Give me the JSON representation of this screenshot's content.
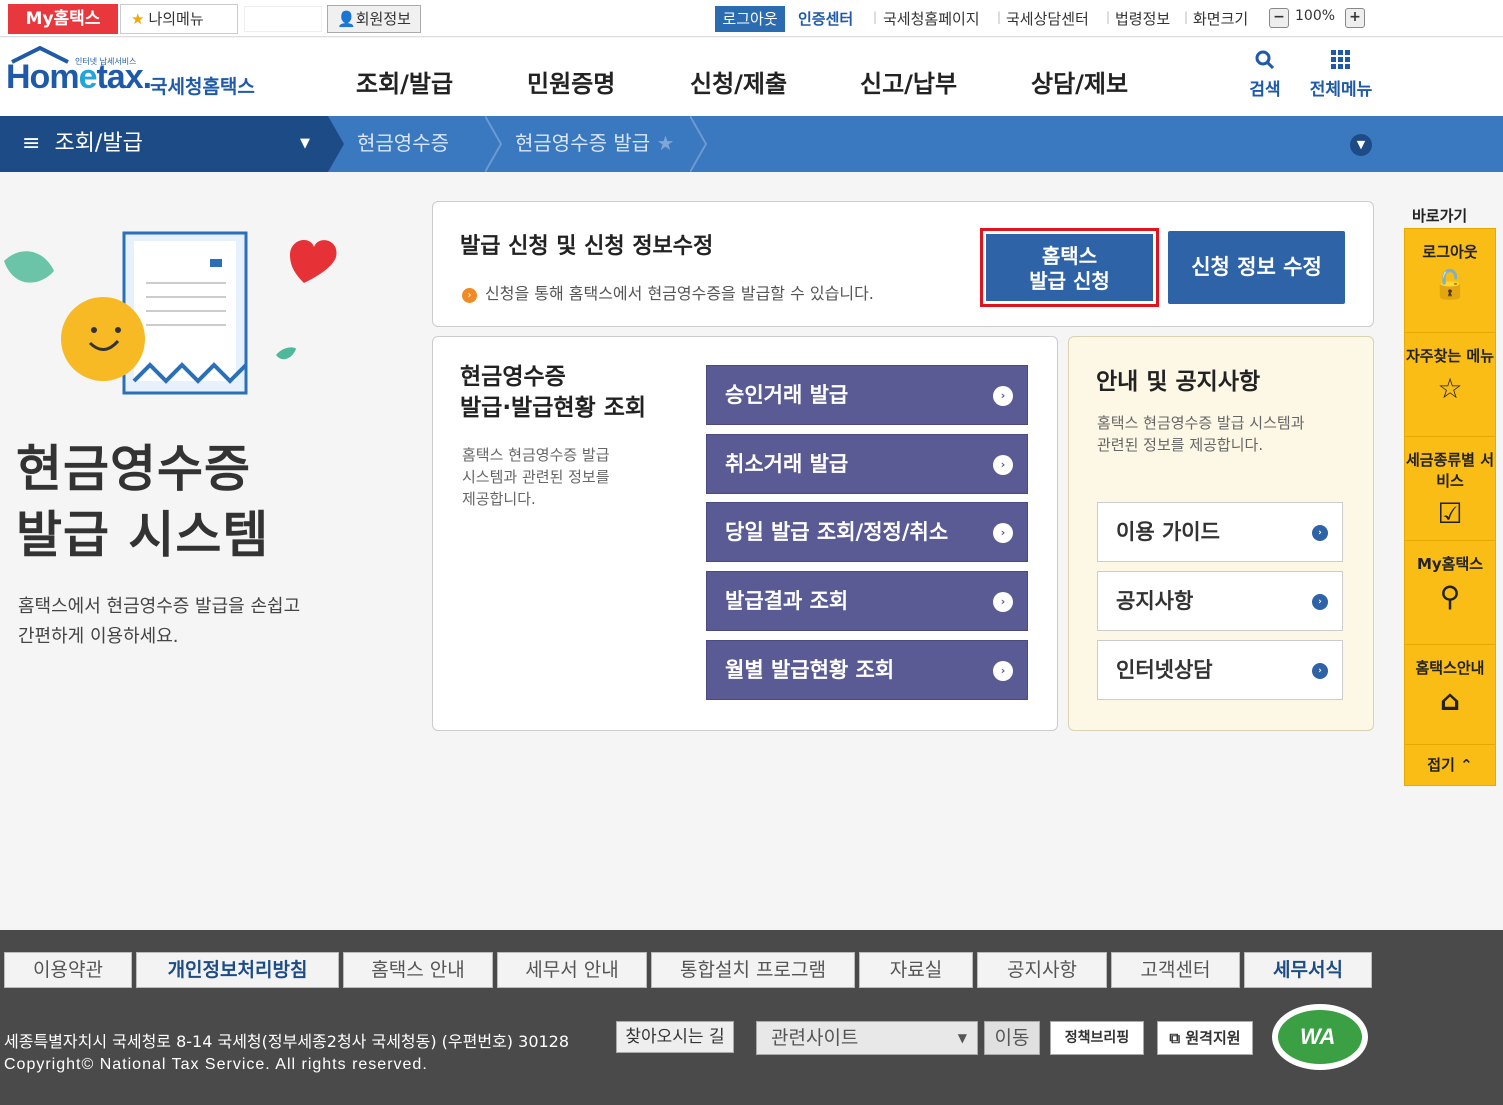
{
  "topbar": {
    "my_hometax": "My홈택스",
    "my_menu": "나의메뉴",
    "member_info": "회원정보",
    "logout": "로그아웃",
    "links": [
      "인증센터",
      "국세청홈페이지",
      "국세상담센터",
      "법령정보",
      "화면크기"
    ],
    "zoom": "100%"
  },
  "header": {
    "logo_text_a": "Hom",
    "logo_text_b": "e",
    "logo_text_c": "tax.",
    "logo_small": "인터넷 납세서비스",
    "logo_kor": "국세청홈택스",
    "nav": [
      "조회/발급",
      "민원증명",
      "신청/제출",
      "신고/납부",
      "상담/제보"
    ],
    "search": "검색",
    "all_menu": "전체메뉴"
  },
  "breadcrumb": {
    "main": "조회/발급",
    "items": [
      "현금영수증",
      "현금영수증 발급"
    ]
  },
  "hero": {
    "title_line1": "현금영수증",
    "title_line2": "발급 시스템",
    "desc_line1": "홈택스에서 현금영수증 발급을 손쉽고",
    "desc_line2": "간편하게 이용하세요."
  },
  "apply_panel": {
    "title": "발급 신청 및 신청 정보수정",
    "desc": "신청을 통해 홈택스에서 현금영수증을 발급할 수 있습니다.",
    "btn_apply_line1": "홈택스",
    "btn_apply_line2": "발급 신청",
    "btn_modify": "신청 정보 수정"
  },
  "query_panel": {
    "title_line1": "현금영수증",
    "title_line2": "발급·발급현황 조회",
    "desc_line1": "홈택스 현금영수증 발급",
    "desc_line2": "시스템과 관련된 정보를",
    "desc_line3": "제공합니다.",
    "buttons": [
      "승인거래 발급",
      "취소거래 발급",
      "당일 발급 조회/정정/취소",
      "발급결과 조회",
      "월별 발급현황 조회"
    ]
  },
  "notice_panel": {
    "title": "안내 및 공지사항",
    "desc_line1": "홈택스 현금영수증 발급 시스템과",
    "desc_line2": "관련된 정보를 제공합니다.",
    "buttons": [
      "이용 가이드",
      "공지사항",
      "인터넷상담"
    ]
  },
  "quick": {
    "label": "바로가기",
    "items": [
      "로그아웃",
      "자주찾는 메뉴",
      "세금종류별 서비스",
      "My홈택스",
      "홈택스안내"
    ],
    "collapse": "접기"
  },
  "footer": {
    "links": [
      "이용약관",
      "개인정보처리방침",
      "홈택스 안내",
      "세무서 안내",
      "통합설치 프로그램",
      "자료실",
      "공지사항",
      "고객센터",
      "세무서식"
    ],
    "address": "세종특별자치시 국세청로 8-14 국세청(정부세종2청사 국세청동) (우편번호) 30128",
    "find_way": "찾아오시는 길",
    "related": "관련사이트",
    "move": "이동",
    "policy": "정책브리핑",
    "remote": "원격지원",
    "copyright": "Copyright© National Tax Service. All rights reserved."
  },
  "colors": {
    "brand_blue": "#1e5aa8",
    "bc_bar": "#3a78c0",
    "query_btn": "#5a5a95",
    "quick_yellow": "#f9bd16",
    "highlight_red": "#e0141e"
  }
}
